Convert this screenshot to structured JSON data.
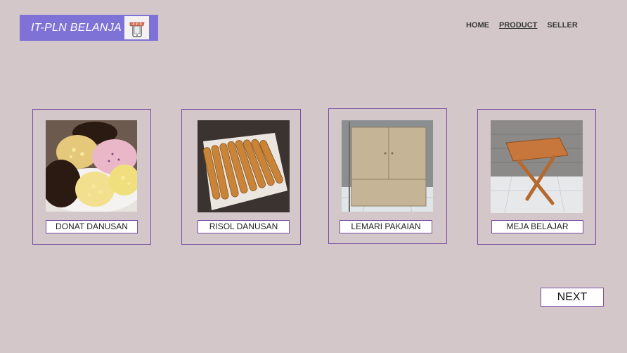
{
  "brand": {
    "title": "IT-PLN BELANJA",
    "icon": "store-phone-icon"
  },
  "nav": {
    "items": [
      "HOME",
      "PRODUCT",
      "SELLER"
    ],
    "active": "PRODUCT"
  },
  "products": [
    {
      "name": "DONAT DANUSAN",
      "image": "donut-photo"
    },
    {
      "name": "RISOL DANUSAN",
      "image": "risol-photo"
    },
    {
      "name": "LEMARI PAKAIAN",
      "image": "wardrobe-photo"
    },
    {
      "name": "MEJA BELAJAR",
      "image": "study-table-photo"
    }
  ],
  "next_label": "NEXT",
  "colors": {
    "background": "#d3c7ca",
    "brand": "#7f72d6",
    "border": "#7a4ea3"
  }
}
